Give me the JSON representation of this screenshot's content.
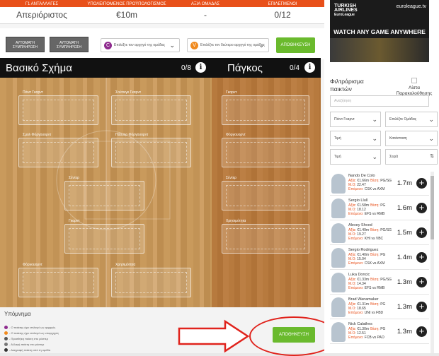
{
  "header": {
    "labels": [
      "Γ1 ΑΝΤΑΛΛΑΓΕΣ",
      "ΥΠΟΛΕΙΠΟΜΕΝΟΣ ΠΡΟΫΠΟΛΟΓΙΣΜΟΣ",
      "ΑΞΙΑ ΟΜΑΔΑΣ",
      "ΕΠΙΛΕΓΜΕΝΟΙ"
    ],
    "values": [
      "Απεριόριστος",
      "€10m",
      "-",
      "0/12"
    ]
  },
  "controls": {
    "autofill1": "ΑΥΤΟΜΑΤΗ ΣΥΜΠΛΗΡΩΣΗ",
    "autofill2": "ΑΥΤΟΜΑΤΗ ΣΥΜΠΛΗΡΩΣΗ",
    "captain_badge": "C",
    "captain_placeholder": "Επιλέξτε τον αρχηγό της ομάδας",
    "vice_badge": "V",
    "vice_placeholder": "Επιλέξτε τον δεύτερο αρχηγό της ομάδας",
    "save": "ΑΠΟΘΗΚΕΥΣΗ",
    "captain_color": "#8e2a8e",
    "vice_color": "#f08a1e"
  },
  "lineup": {
    "title": "Βασικό Σχήμα",
    "count": "0/8",
    "slots": [
      "Πόιντ Γκαρντ",
      "Σούτινγκ Γκαρντ",
      "Σμολ Φόργουορντ",
      "Πάουερ Φόργουορντ",
      "Σέντερ",
      "Γκαρντ",
      "Φόργουορντ",
      "Χρησιμότητα"
    ]
  },
  "bench": {
    "title": "Πάγκος",
    "count": "0/4",
    "slots": [
      "Γκαρντ",
      "Φόργουορντ",
      "Σέντερ",
      "Χρησιμότητα"
    ]
  },
  "legend": {
    "title": "Υπόμνημα",
    "items": [
      {
        "text": "- Ο παίκτης έχει επιλεγεί ως αρχηγός",
        "color": "#8e2a8e"
      },
      {
        "text": "- Ο παίκτης έχει επιλεγεί ως υπαρχηγός",
        "color": "#f08a1e"
      },
      {
        "text": "- Προσθήκη παίκτη στο ρόστερ",
        "color": "#555555"
      },
      {
        "text": "- Αλλαγή παίκτη στο ρόστερ",
        "color": "#777777"
      },
      {
        "text": "- Διαγραφή παίκτη από τη ομάδα",
        "color": "#333333"
      }
    ],
    "save": "ΑΠΟΘΗΚΕΥΣΗ"
  },
  "ad": {
    "airline_line1": "TURKISH",
    "airline_line2": "AIRLINES",
    "airline_line3": "EuroLeague",
    "site": "euroleague.tv",
    "slogan": "WATCH ANY GAME ANYWHERE"
  },
  "filters": {
    "title": "Φιλτράρισμα παικτών",
    "watchlist": "Λίστα Παρακολούθησης",
    "search_placeholder": "Αναζήτηση",
    "position": "Πόιντ Γκαρντ",
    "team": "Επιλέξτε Ομάδας",
    "price": "Τιμή",
    "status": "Κατάσταση",
    "value": "Τιμή",
    "sort": "Σειρά"
  },
  "players": [
    {
      "name": "Nando De Colo",
      "avg": "€1.66m",
      "pos": "PG/SG",
      "md": "22.47",
      "next": "CSK vs AXM",
      "value": "1.7m"
    },
    {
      "name": "Sergio Llull",
      "avg": "€1.58m",
      "pos": "PG",
      "md": "18.12",
      "next": "EFS vs RMB",
      "value": "1.6m"
    },
    {
      "name": "Alexey Shved",
      "avg": "€1.49m",
      "pos": "PG/SG",
      "md": "19.27",
      "next": "KHI vs VBC",
      "value": "1.5m"
    },
    {
      "name": "Sergio Rodriguez",
      "avg": "€1.40m",
      "pos": "PG",
      "md": "15.04",
      "next": "CSK vs AXM",
      "value": "1.4m"
    },
    {
      "name": "Luka Doncic",
      "avg": "€1.33m",
      "pos": "PG/SG",
      "md": "14.34",
      "next": "EFS vs RMB",
      "value": "1.3m"
    },
    {
      "name": "Brad Wanamaker",
      "avg": "€1.31m",
      "pos": "PG",
      "md": "18.65",
      "next": "UNI vs FBD",
      "value": "1.3m"
    },
    {
      "name": "Nick Calathes",
      "avg": "€1.30m",
      "pos": "PG",
      "md": "12.51",
      "next": "FCB vs PAO",
      "value": "1.3m"
    }
  ],
  "player_labels": {
    "avg": "Αξία:",
    "pos": "Θέση:",
    "md": "Μ.Ο:",
    "next": "Επόμενο:"
  }
}
